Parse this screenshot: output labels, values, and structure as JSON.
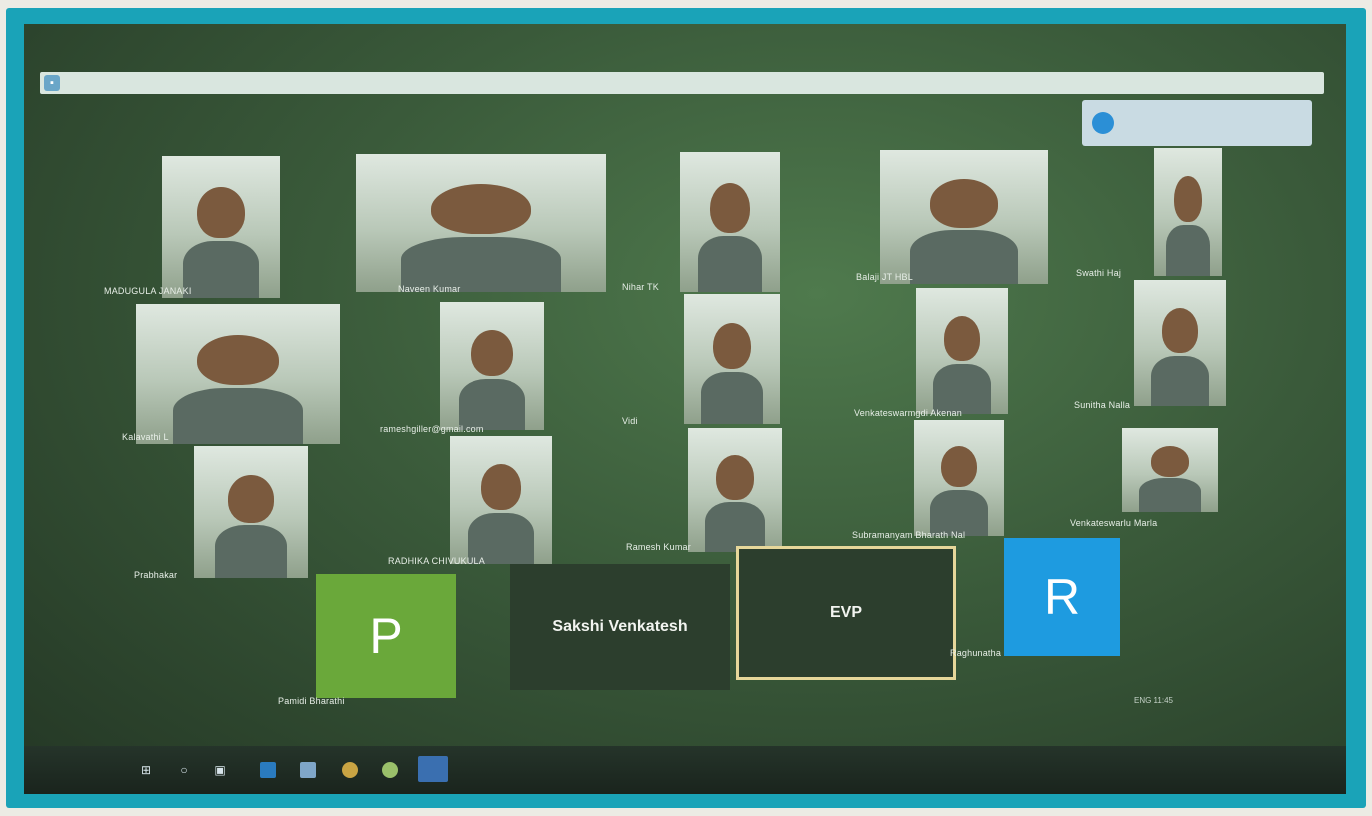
{
  "window": {
    "title_icon": "app-icon"
  },
  "notification": {
    "text": ""
  },
  "participants": [
    {
      "name": "MADUGULA JANAKI",
      "kind": "video"
    },
    {
      "name": "Naveen Kumar",
      "kind": "video"
    },
    {
      "name": "Nihar TK",
      "kind": "video"
    },
    {
      "name": "Balaji JT HBL",
      "kind": "video"
    },
    {
      "name": "Swathi Haj",
      "kind": "video"
    },
    {
      "name": "Kalavathi L",
      "kind": "video"
    },
    {
      "name": "rameshgiller@gmail.com",
      "kind": "video"
    },
    {
      "name": "Vidi",
      "kind": "video"
    },
    {
      "name": "Venkateswarmgdi Akenan",
      "kind": "video"
    },
    {
      "name": "Sunitha Nalla",
      "kind": "video"
    },
    {
      "name": "Prabhakar",
      "kind": "video"
    },
    {
      "name": "RADHIKA CHIVUKULA",
      "kind": "video"
    },
    {
      "name": "Ramesh Kumar",
      "kind": "video"
    },
    {
      "name": "Subramanyam Bharath Nal",
      "kind": "video"
    },
    {
      "name": "Venkateswarlu Marla",
      "kind": "video"
    },
    {
      "name": "Pamidi Bharathi",
      "kind": "avatar",
      "initial": "P",
      "color": "#6aa83a"
    },
    {
      "name": "Sakshi Venkatesh",
      "kind": "name"
    },
    {
      "name": "EVP",
      "kind": "name",
      "highlight": "#e6d79a"
    },
    {
      "name": "Raghunatha",
      "kind": "avatar",
      "initial": "R",
      "color": "#1e9be0"
    }
  ],
  "taskbar": {
    "icons": [
      "windows-icon",
      "search-icon",
      "task-view-icon",
      "edge-icon",
      "mail-icon",
      "chrome-icon",
      "chrome-icon",
      "teams-icon"
    ]
  },
  "tray": {
    "text": "ENG 11:45"
  }
}
